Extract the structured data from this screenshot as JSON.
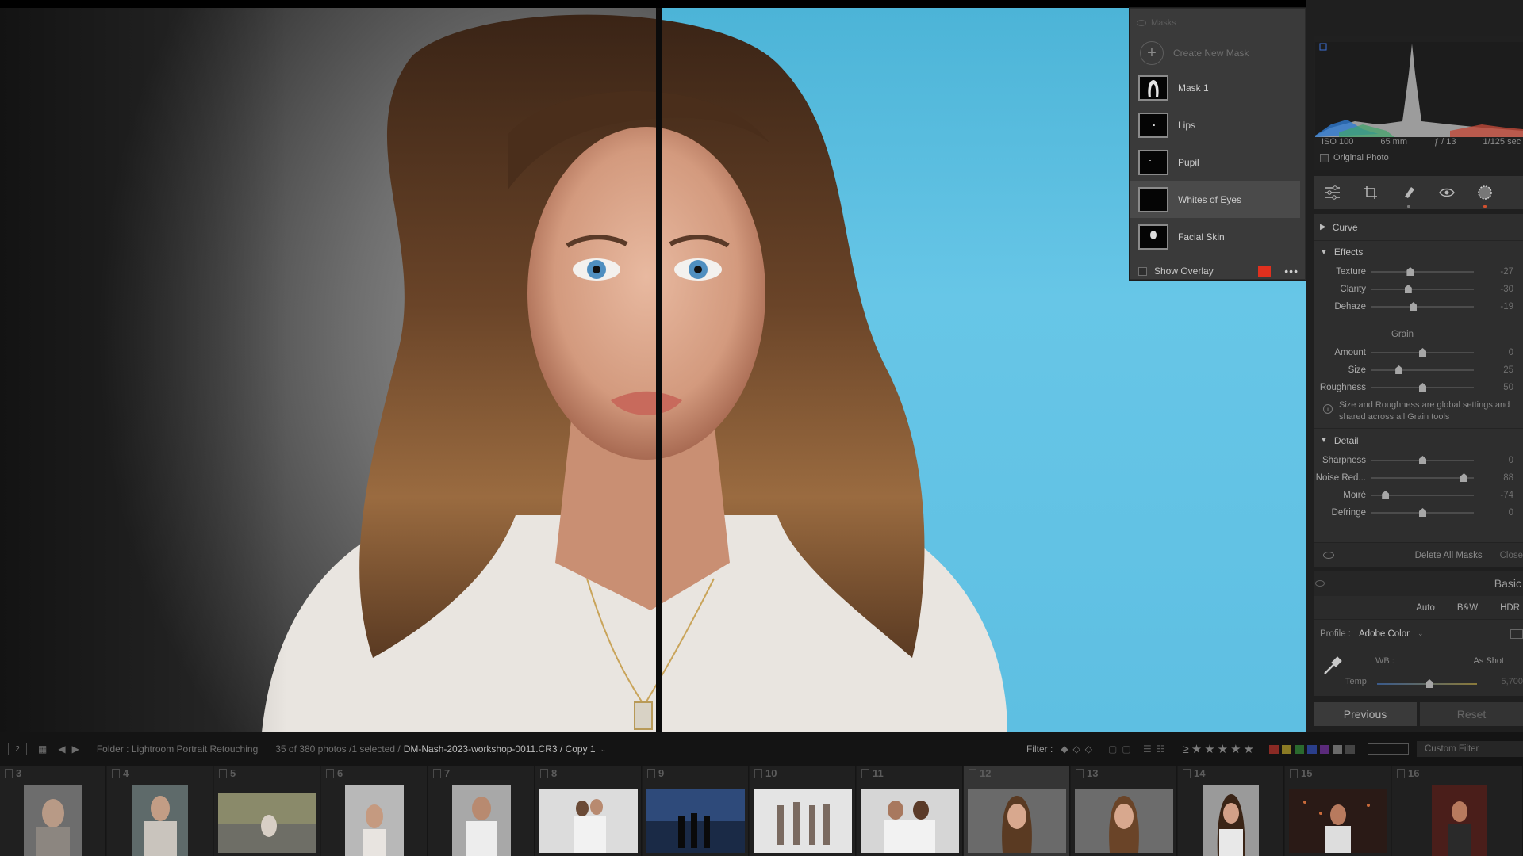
{
  "masks": {
    "header": "Masks",
    "create_label": "Create New Mask",
    "items": [
      {
        "label": "Mask 1"
      },
      {
        "label": "Lips"
      },
      {
        "label": "Pupil"
      },
      {
        "label": "Whites of Eyes"
      },
      {
        "label": "Facial Skin"
      }
    ],
    "show_overlay": "Show Overlay",
    "overlay_color": "#e0301e"
  },
  "histogram": {
    "iso": "ISO 100",
    "focal": "65 mm",
    "aperture": "ƒ / 13",
    "shutter": "1/125 sec",
    "original_photo": "Original Photo"
  },
  "effects": {
    "curve_label": "Curve",
    "effects_label": "Effects",
    "texture": {
      "label": "Texture",
      "value": "-27",
      "pos": 0.38
    },
    "clarity": {
      "label": "Clarity",
      "value": "-30",
      "pos": 0.36
    },
    "dehaze": {
      "label": "Dehaze",
      "value": "-19",
      "pos": 0.41
    },
    "grain_label": "Grain",
    "amount": {
      "label": "Amount",
      "value": "0",
      "pos": 0.5
    },
    "size": {
      "label": "Size",
      "value": "25",
      "pos": 0.27
    },
    "roughness": {
      "label": "Roughness",
      "value": "50",
      "pos": 0.5
    },
    "grain_note": "Size and Roughness are global settings and shared across all Grain tools",
    "detail_label": "Detail",
    "sharpness": {
      "label": "Sharpness",
      "value": "0",
      "pos": 0.5
    },
    "noise": {
      "label": "Noise Red...",
      "value": "88",
      "pos": 0.9
    },
    "moire": {
      "label": "Moiré",
      "value": "-74",
      "pos": 0.14
    },
    "defringe": {
      "label": "Defringe",
      "value": "0",
      "pos": 0.5
    },
    "delete_all": "Delete All Masks",
    "close": "Close"
  },
  "basic": {
    "title": "Basic",
    "auto": "Auto",
    "bw": "B&W",
    "hdr": "HDR",
    "profile_label": "Profile :",
    "profile_value": "Adobe Color",
    "wb_label": "WB :",
    "wb_value": "As Shot",
    "temp_label": "Temp",
    "temp_value": "5,700",
    "temp_pos": 0.52
  },
  "nav": {
    "previous": "Previous",
    "reset": "Reset"
  },
  "filmbar": {
    "page": "2",
    "folder": "Folder : Lightroom Portrait Retouching",
    "count": "35 of 380 photos /1 selected /",
    "file": "DM-Nash-2023-workshop-0011.CR3 / Copy 1",
    "filter_label": "Filter :",
    "custom_filter": "Custom Filter"
  },
  "filmstrip": {
    "numbers": [
      "3",
      "4",
      "5",
      "6",
      "7",
      "8",
      "9",
      "10",
      "11",
      "12",
      "13",
      "14",
      "15",
      "16"
    ]
  }
}
